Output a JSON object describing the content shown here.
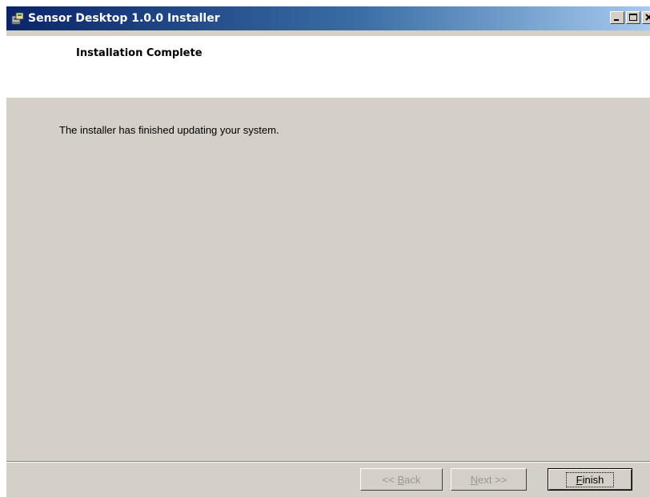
{
  "window": {
    "title": "Sensor Desktop 1.0.0 Installer",
    "icons": {
      "app": "installer-icon",
      "minimize": "minimize-icon",
      "maximize": "maximize-icon",
      "close": "close-icon"
    },
    "colors": {
      "titlebar_start": "#0a246a",
      "titlebar_end": "#a6caf0",
      "face": "#d4d0c8"
    }
  },
  "header": {
    "title": "Installation Complete"
  },
  "body": {
    "message": "The installer has finished updating your system."
  },
  "buttons": {
    "back": {
      "prefix": "<< ",
      "accel": "B",
      "rest": "ack",
      "enabled": false
    },
    "next": {
      "prefix": "",
      "accel": "N",
      "rest": "ext >>",
      "enabled": false
    },
    "finish": {
      "prefix": "",
      "accel": "F",
      "rest": "inish",
      "enabled": true
    }
  }
}
